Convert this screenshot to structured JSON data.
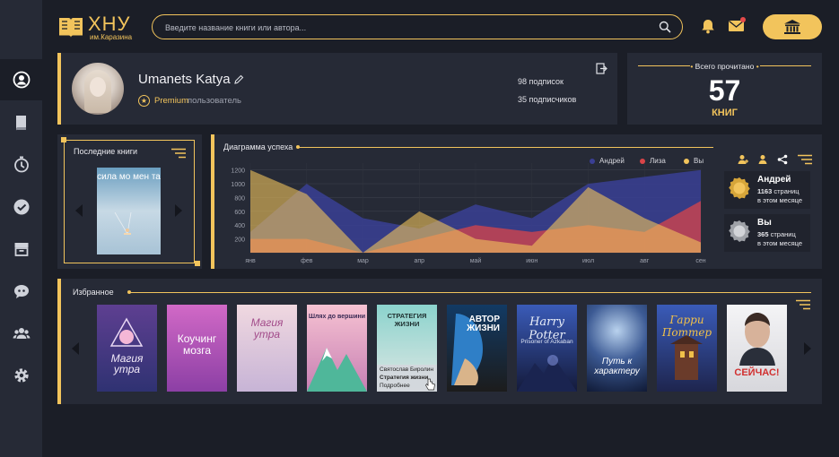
{
  "logo": {
    "title": "ХНУ",
    "subtitle": "им.Каразина"
  },
  "search": {
    "placeholder": "Введите название книги или автора..."
  },
  "profile": {
    "name": "Umanets Katya",
    "premium": "Premium",
    "premium_rest": "пользователь",
    "subscriptions": "98 подписок",
    "subscribers": "35 подписчиков"
  },
  "total": {
    "label": "Всего прочитано",
    "count": "57",
    "unit": "КНИГ"
  },
  "last_books": {
    "title": "Последние книги",
    "cover_title": "сила мо мен та"
  },
  "chart": {
    "title": "Диаграмма успеха"
  },
  "chart_data": {
    "type": "area",
    "title": "Диаграмма успеха",
    "categories": [
      "янв",
      "фев",
      "мар",
      "апр",
      "май",
      "июн",
      "июл",
      "авг",
      "сен"
    ],
    "yticks": [
      "1200",
      "1000",
      "800",
      "600",
      "400",
      "200"
    ],
    "ylim": [
      0,
      1300
    ],
    "series": [
      {
        "name": "Андрей",
        "color": "#3a3f94",
        "values": [
          300,
          1000,
          500,
          350,
          700,
          500,
          1000,
          1100,
          1200
        ]
      },
      {
        "name": "Лиза",
        "color": "#d94448",
        "values": [
          200,
          200,
          0,
          200,
          400,
          300,
          400,
          300,
          750
        ]
      },
      {
        "name": "Вы",
        "color": "#f2c45c",
        "values": [
          1200,
          850,
          0,
          600,
          200,
          100,
          950,
          500,
          150
        ]
      }
    ],
    "grid": true,
    "legend": "top-right"
  },
  "ranks": [
    {
      "name": "Андрей",
      "pages": "1163",
      "pages_word": "страниц",
      "period": "в этом месяце"
    },
    {
      "name": "Вы",
      "pages": "365",
      "pages_word": "страниц",
      "period": "в этом месяце"
    }
  ],
  "favorites": {
    "title": "Избранное",
    "hover": {
      "author": "Святослав Биролин",
      "title": "Стратегия жизни",
      "more": "Подробнее"
    },
    "books": [
      {
        "title": "Магия утра",
        "bg": "#3a3a7a"
      },
      {
        "title": "Коучинг мозга",
        "bg": "#c14fb5"
      },
      {
        "title": "Магия утра",
        "bg": "#e7c9d6"
      },
      {
        "title": "Шлях до вершини",
        "bg": "#f1a9c3"
      },
      {
        "title": "СТРАТЕГИЯ ЖИЗНИ",
        "bg": "#7fc7c3"
      },
      {
        "title": "АВТОР ЖИЗНИ",
        "bg": "#1e4e7a"
      },
      {
        "title": "Harry Potter",
        "subtitle": "Prisoner of Azkaban",
        "bg": "#273a8a"
      },
      {
        "title": "Путь к характеру",
        "bg": "#1d3664"
      },
      {
        "title": "Гарри Поттер",
        "bg": "#2a3c7a"
      },
      {
        "title": "СЕЙЧАС!",
        "bg": "#e8e8ea"
      }
    ]
  }
}
